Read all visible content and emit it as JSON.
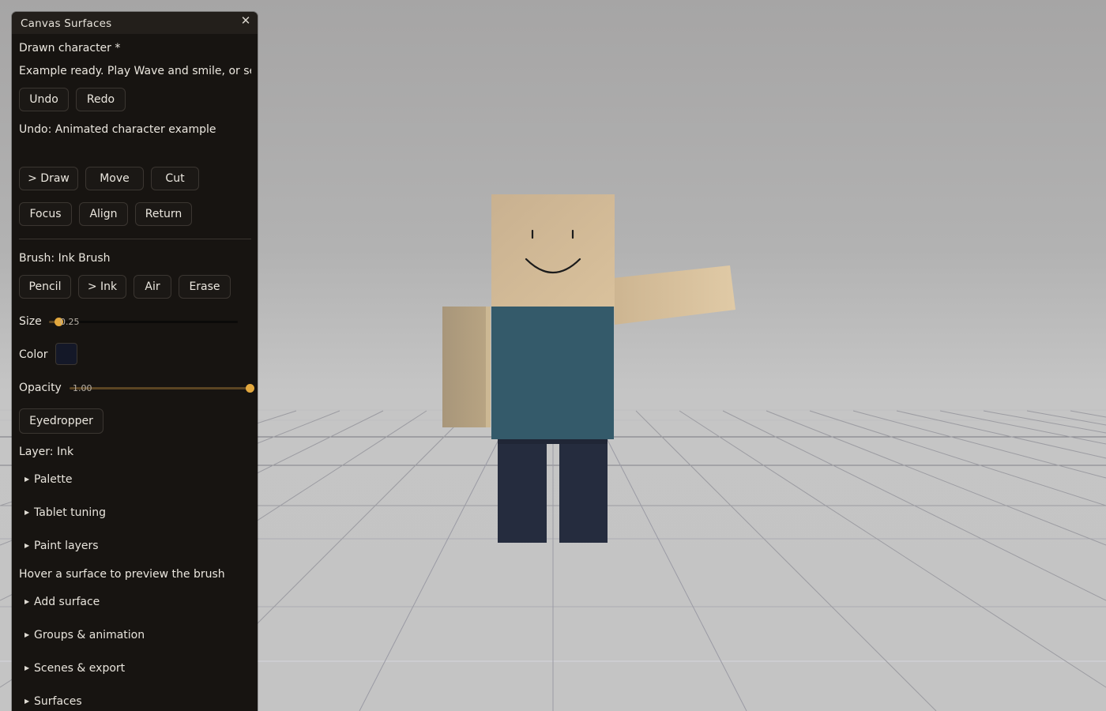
{
  "panel": {
    "title": "Canvas Surfaces",
    "close_icon": "close-icon",
    "document_name": "Drawn character *",
    "status": "Example ready. Play Wave and smile, or select a surface",
    "undo_label": "Undo",
    "redo_label": "Redo",
    "undo_hint": "Undo: Animated character example",
    "tools": [
      "> Draw",
      "Move",
      "Cut"
    ],
    "view_buttons": [
      "Focus",
      "Align",
      "Return"
    ],
    "brush_label": "Brush: Ink Brush",
    "brushes": [
      "Pencil",
      "> Ink",
      "Air",
      "Erase"
    ],
    "size_label": "Size",
    "size_value": "0.25",
    "size_fraction": 0.05,
    "color_label": "Color",
    "brush_color": "#141828",
    "opacity_label": "Opacity",
    "opacity_value": "1.00",
    "opacity_fraction": 1.0,
    "eyedropper_label": "Eyedropper",
    "layer_label": "Layer: Ink",
    "sections_a": [
      "Palette",
      "Tablet tuning",
      "Paint layers"
    ],
    "hover_hint": "Hover a surface to preview the brush",
    "sections_b": [
      "Add surface",
      "Groups & animation",
      "Scenes & export",
      "Surfaces"
    ]
  },
  "colors": {
    "accent": "#e3a83e",
    "panel_bg": "#171411",
    "skin": "#d6bd98",
    "shirt": "#345a6a",
    "pants": "#252c3e"
  }
}
